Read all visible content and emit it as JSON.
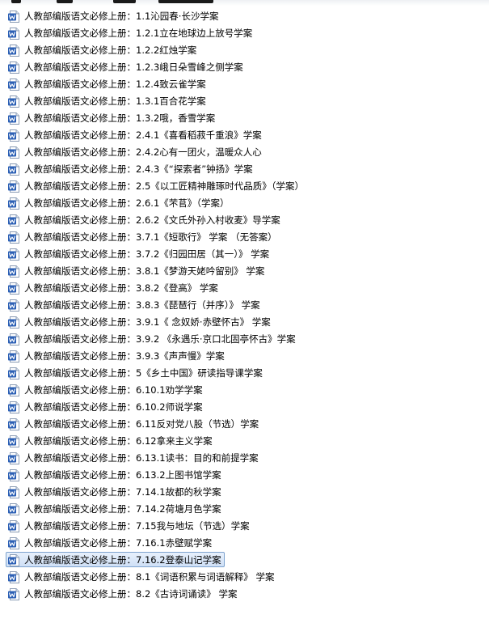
{
  "colors": {
    "icon_blue": "#2b5fb4",
    "selection_border": "#7da2ce",
    "selection_fill": "#d8e6f8",
    "text": "#000000"
  },
  "icon": "word-document-icon",
  "selected_index": 34,
  "files": [
    {
      "name": "人教部编版语文必修上册：1.1沁园春·长沙学案"
    },
    {
      "name": "人教部编版语文必修上册：1.2.1立在地球边上放号学案"
    },
    {
      "name": "人教部编版语文必修上册：1.2.2红烛学案"
    },
    {
      "name": "人教部编版语文必修上册：1.2.3峨日朵雪峰之侧学案"
    },
    {
      "name": "人教部编版语文必修上册：1.2.4致云雀学案"
    },
    {
      "name": "人教部编版语文必修上册：1.3.1百合花学案"
    },
    {
      "name": "人教部编版语文必修上册：1.3.2哦，香雪学案"
    },
    {
      "name": "人教部编版语文必修上册：2.4.1《喜看稻菽千重浪》学案"
    },
    {
      "name": "人教部编版语文必修上册：2.4.2心有一团火，温暖众人心"
    },
    {
      "name": "人教部编版语文必修上册：2.4.3《“探索者”钟扬》学案"
    },
    {
      "name": "人教部编版语文必修上册：2.5《以工匠精神雕琢时代品质》（学案）"
    },
    {
      "name": "人教部编版语文必修上册：2.6.1《芣苢》（学案）"
    },
    {
      "name": "人教部编版语文必修上册：2.6.2《文氏外孙入村收麦》导学案"
    },
    {
      "name": "人教部编版语文必修上册：3.7.1《短歌行》 学案 （无答案）"
    },
    {
      "name": "人教部编版语文必修上册：3.7.2《归园田居（其一）》 学案"
    },
    {
      "name": "人教部编版语文必修上册：3.8.1《梦游天姥吟留别》 学案"
    },
    {
      "name": "人教部编版语文必修上册：3.8.2《登高》 学案"
    },
    {
      "name": "人教部编版语文必修上册：3.8.3《琵琶行（并序）》 学案"
    },
    {
      "name": "人教部编版语文必修上册：3.9.1《 念奴娇·赤壁怀古》 学案"
    },
    {
      "name": "人教部编版语文必修上册：3.9.2 《永遇乐·京口北固亭怀古》学案"
    },
    {
      "name": "人教部编版语文必修上册：3.9.3《声声慢》学案"
    },
    {
      "name": "人教部编版语文必修上册：5《乡土中国》研读指导课学案"
    },
    {
      "name": "人教部编版语文必修上册：6.10.1劝学学案"
    },
    {
      "name": "人教部编版语文必修上册：6.10.2师说学案"
    },
    {
      "name": "人教部编版语文必修上册：6.11反对党八股（节选）学案"
    },
    {
      "name": "人教部编版语文必修上册：6.12拿来主义学案"
    },
    {
      "name": "人教部编版语文必修上册：6.13.1读书：目的和前提学案"
    },
    {
      "name": "人教部编版语文必修上册：6.13.2上图书馆学案"
    },
    {
      "name": "人教部编版语文必修上册：7.14.1故都的秋学案"
    },
    {
      "name": "人教部编版语文必修上册：7.14.2荷塘月色学案"
    },
    {
      "name": "人教部编版语文必修上册：7.15我与地坛（节选）学案"
    },
    {
      "name": "人教部编版语文必修上册：7.16.1赤壁赋学案"
    },
    {
      "name": "人教部编版语文必修上册：7.16.2登泰山记学案"
    },
    {
      "name": "人教部编版语文必修上册：8.1《词语积累与词语解释》 学案"
    },
    {
      "name": "人教部编版语文必修上册：8.2《古诗词诵读》 学案"
    }
  ]
}
